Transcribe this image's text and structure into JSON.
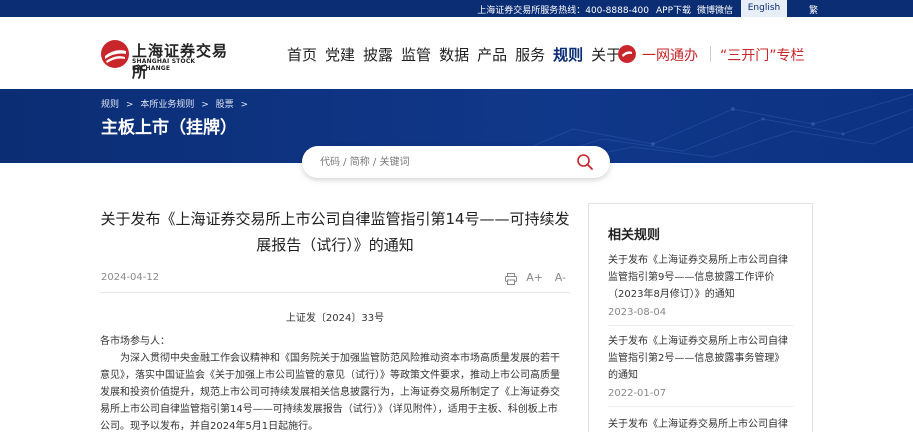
{
  "topbar": {
    "hotline": "上海证券交易所服务热线：400-8888-400",
    "app": "APP下载",
    "weibo": "微博微信",
    "english": "English",
    "traditional": "繁"
  },
  "header": {
    "logo_cn": "上海证券交易所",
    "logo_en": "SHANGHAI STOCK EXCHANGE",
    "nav": [
      "首页",
      "党建",
      "披露",
      "监管",
      "数据",
      "产品",
      "服务",
      "规则",
      "关于"
    ],
    "active_nav": "规则",
    "yiwang": "一网通办",
    "sankai": "“三开门”专栏"
  },
  "banner": {
    "breadcrumb": [
      "规则",
      ">",
      "本所业务规则",
      ">",
      "股票",
      ">"
    ],
    "title": "主板上市（挂牌）"
  },
  "search": {
    "placeholder": "代码 / 简称 / 关键词"
  },
  "article": {
    "title": "关于发布《上海证券交易所上市公司自律监管指引第14号——可持续发展报告（试行）》的通知",
    "date": "2024-04-12",
    "font_up": "A+",
    "font_down": "A-",
    "doc_no": "上证发〔2024〕33号",
    "salutation": "各市场参与人：",
    "paragraph": "为深入贯彻中央金融工作会议精神和《国务院关于加强监管防范风险推动资本市场高质量发展的若干意见》，落实中国证监会《关于加强上市公司监管的意见（试行）》等政策文件要求，推动上市公司高质量发展和投资价值提升，规范上市公司可持续发展相关信息披露行为，上海证券交易所制定了《上海证券交易所上市公司自律监管指引第14号——可持续发展报告（试行）》（详见附件），适用于主板、科创板上市公司。现予以发布，并自2024年5月1日起施行。"
  },
  "sidebar": {
    "title": "相关规则",
    "items": [
      {
        "title": "关于发布《上海证券交易所上市公司自律监管指引第9号——信息披露工作评价（2023年8月修订）》的通知",
        "date": "2023-08-04"
      },
      {
        "title": "关于发布《上海证券交易所上市公司自律监管指引第2号——信息披露事务管理》的通知",
        "date": "2022-01-07"
      },
      {
        "title": "关于发布《上海证券交易所上市公司自律",
        "date": ""
      }
    ]
  },
  "colors": {
    "brand_blue": "#0b2d74",
    "accent_red": "#c8262a"
  }
}
